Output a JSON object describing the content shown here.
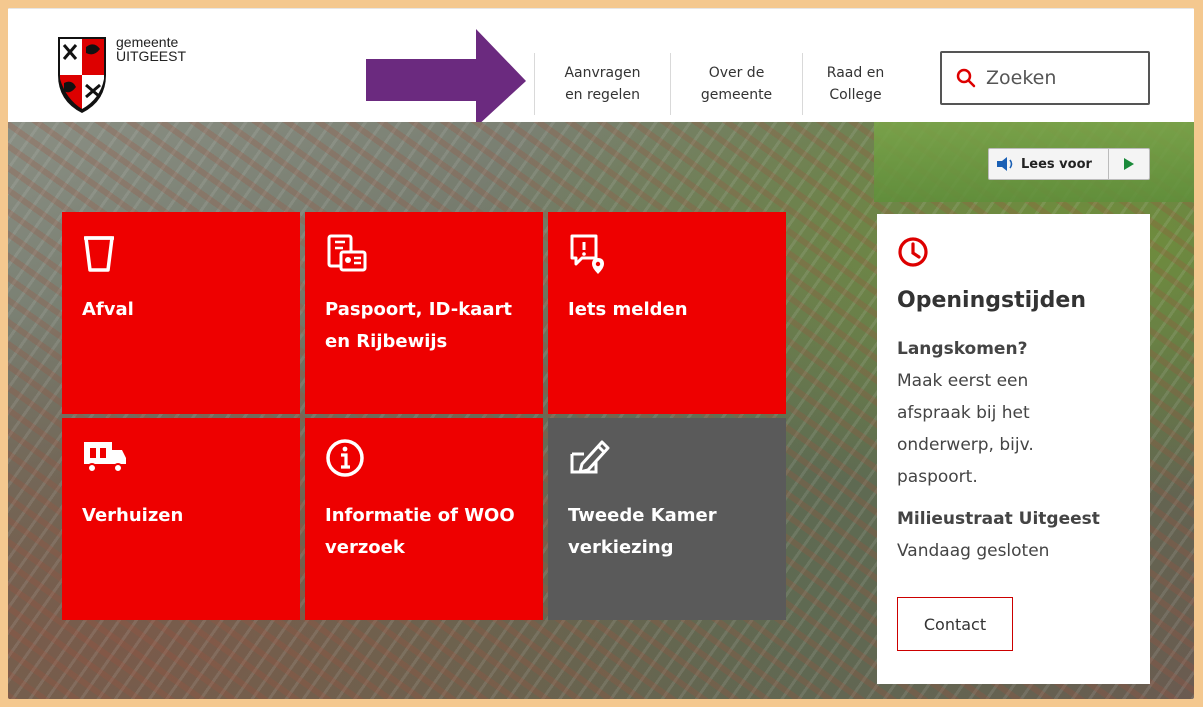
{
  "logo": {
    "line1": "gemeente",
    "line2": "UITGEEST"
  },
  "nav": {
    "items": [
      {
        "label": "Aanvragen\nen regelen"
      },
      {
        "label": "Over de\ngemeente"
      },
      {
        "label": "Raad en\nCollege"
      }
    ]
  },
  "search": {
    "placeholder": "Zoeken"
  },
  "lees_voor": {
    "label": "Lees voor"
  },
  "tiles": [
    {
      "label": "Afval",
      "icon": "trash-bin-icon"
    },
    {
      "label": "Paspoort, ID-kaart\nen Rijbewijs",
      "icon": "id-documents-icon"
    },
    {
      "label": "Iets melden",
      "icon": "report-location-icon"
    },
    {
      "label": "Verhuizen",
      "icon": "moving-truck-icon"
    },
    {
      "label": "Informatie of WOO\nverzoek",
      "icon": "info-icon"
    },
    {
      "label": "Tweede Kamer\nverkiezing",
      "icon": "vote-pen-icon"
    }
  ],
  "opening": {
    "title": "Openingstijden",
    "heading1": "Langskomen?",
    "text1": "Maak eerst een\nafspraak bij het\nonderwerp, bijv.\npaspoort.",
    "heading2": "Milieustraat Uitgeest",
    "text2": "Vandaag gesloten",
    "contact_label": "Contact"
  },
  "colors": {
    "accent_red": "#ee0000",
    "tile_grey": "#5a5a5a",
    "frame": "#f4c88f",
    "arrow": "#6b2a7f"
  }
}
